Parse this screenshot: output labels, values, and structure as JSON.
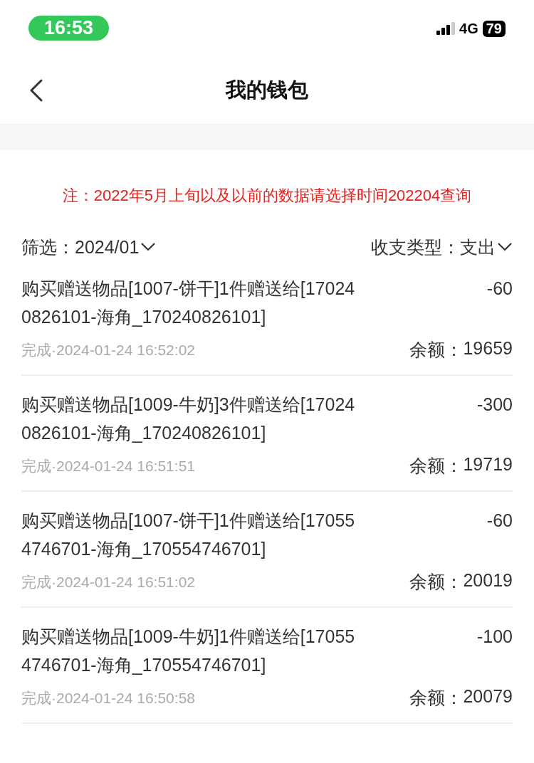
{
  "status_bar": {
    "time": "16:53",
    "network": "4G",
    "battery": "79"
  },
  "nav": {
    "title": "我的钱包"
  },
  "notice": "注：2022年5月上旬以及以前的数据请选择时间202204查询",
  "filters": {
    "date_label": "筛选：",
    "date": "2024/01",
    "type_label": "收支类型：",
    "type": "支出"
  },
  "records": [
    {
      "description": "购买赠送物品[1007-饼干]1件赠送给[170240826101-海角_170240826101]",
      "amount": "-60",
      "status": "完成·2024-01-24 16:52:02",
      "balance_label": "余额：",
      "balance": "19659"
    },
    {
      "description": "购买赠送物品[1009-牛奶]3件赠送给[170240826101-海角_170240826101]",
      "amount": "-300",
      "status": "完成·2024-01-24 16:51:51",
      "balance_label": "余额：",
      "balance": "19719"
    },
    {
      "description": "购买赠送物品[1007-饼干]1件赠送给[170554746701-海角_170554746701]",
      "amount": "-60",
      "status": "完成·2024-01-24 16:51:02",
      "balance_label": "余额：",
      "balance": "20019"
    },
    {
      "description": "购买赠送物品[1009-牛奶]1件赠送给[170554746701-海角_170554746701]",
      "amount": "-100",
      "status": "完成·2024-01-24 16:50:58",
      "balance_label": "余额：",
      "balance": "20079"
    }
  ]
}
